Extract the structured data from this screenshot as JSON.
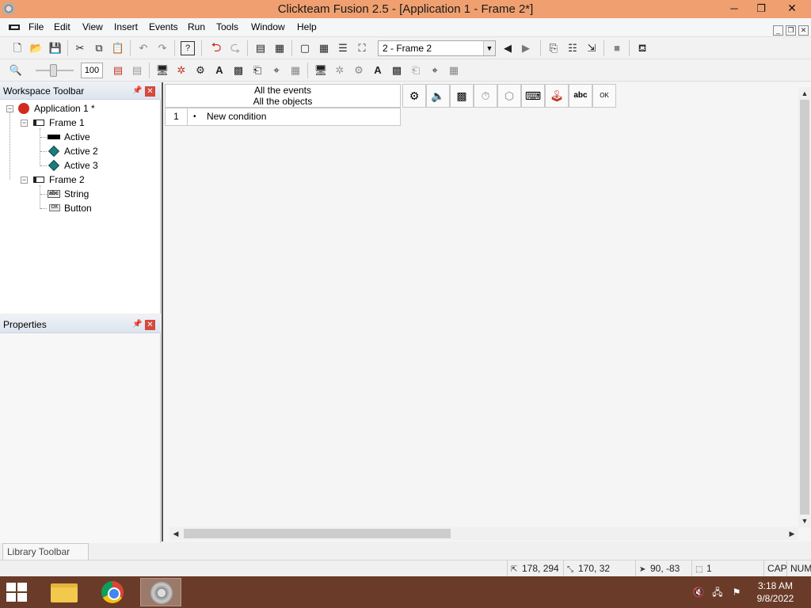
{
  "window": {
    "title": "Clickteam Fusion 2.5 - [Application 1 - Frame 2*]"
  },
  "menu": {
    "items": [
      "File",
      "Edit",
      "View",
      "Insert",
      "Events",
      "Run",
      "Tools",
      "Window",
      "Help"
    ]
  },
  "toolbar": {
    "frame_selector": "2 - Frame 2",
    "zoom_value": "100"
  },
  "workspace": {
    "title": "Workspace Toolbar",
    "tree": {
      "application": "Application 1 *",
      "frame1": "Frame 1",
      "frame1_items": [
        "Active",
        "Active 2",
        "Active 3"
      ],
      "frame2": "Frame 2",
      "frame2_items": [
        "String",
        "Button"
      ]
    }
  },
  "properties": {
    "title": "Properties"
  },
  "library": {
    "title": "Library Toolbar"
  },
  "event_editor": {
    "header_line1": "All the events",
    "header_line2": "All the objects",
    "rows": [
      {
        "num": "1",
        "bullet": "•",
        "condition": "New condition"
      }
    ]
  },
  "status_bar": {
    "pos1": "178, 294",
    "size": "170, 32",
    "mouse": "90, -83",
    "count": "1",
    "caps": "CAP",
    "num": "NUM"
  },
  "taskbar": {
    "time": "3:18 AM",
    "date": "9/8/2022"
  }
}
